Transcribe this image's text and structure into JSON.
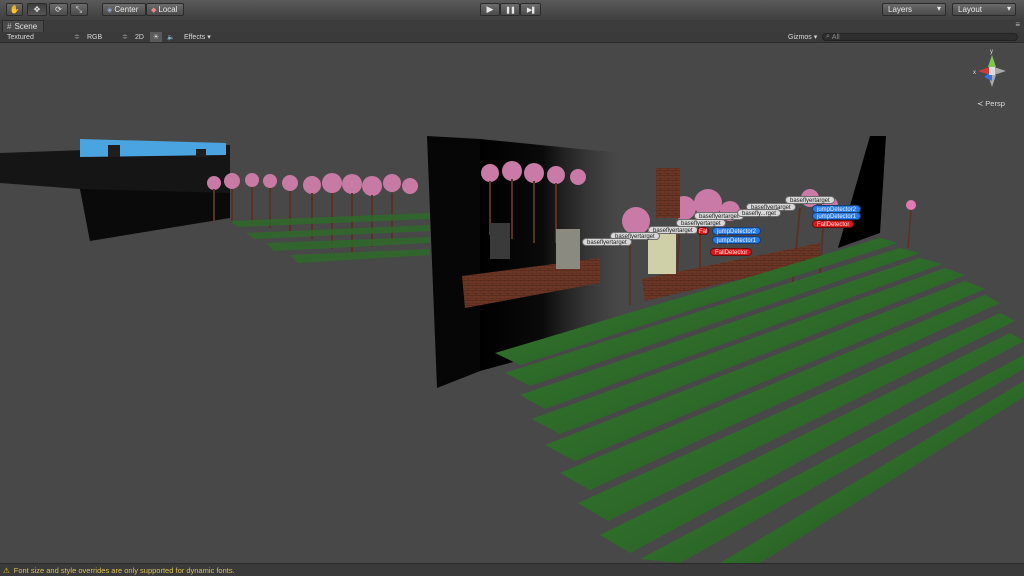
{
  "toolbar": {
    "tools": [
      {
        "name": "hand-tool",
        "glyph": "✋"
      },
      {
        "name": "move-tool",
        "glyph": "✥"
      },
      {
        "name": "rotate-tool",
        "glyph": "⟳"
      },
      {
        "name": "scale-tool",
        "glyph": "⤡"
      }
    ],
    "pivot_label": "Center",
    "space_label": "Local",
    "play_glyph": "▶",
    "pause_glyph": "❚❚",
    "step_glyph": "▶❚",
    "layers_label": "Layers",
    "layout_label": "Layout",
    "dropdown_arrow": "▾"
  },
  "tab": {
    "icon_glyph": "#",
    "label": "Scene"
  },
  "scene_options": {
    "render_mode": "Textured",
    "color_mode": "RGB",
    "mode_2d": "2D",
    "lighting_glyph": "☀",
    "audio_glyph": "🔈",
    "effects": "Effects",
    "gizmos": "Gizmos",
    "search_placeholder": "All",
    "arrow": "▾",
    "small_arrow": "≑"
  },
  "gizmo": {
    "axis_y": "y",
    "axis_x": "x",
    "projection": "Persp",
    "projection_glyph": "≺"
  },
  "object_labels": [
    {
      "text": "baseflyertarget",
      "style": "white"
    },
    {
      "text": "baseflyertarget",
      "style": "white"
    },
    {
      "text": "baseflyertarget",
      "style": "white"
    },
    {
      "text": "baseflyertarget",
      "style": "white"
    },
    {
      "text": "baseflyertarget",
      "style": "white"
    },
    {
      "text": "baseflyertarget",
      "style": "white"
    },
    {
      "text": "basefly...rget",
      "style": "white"
    },
    {
      "text": "baseflyertarget",
      "style": "white"
    },
    {
      "text": "jumpDetector2",
      "style": "blue"
    },
    {
      "text": "jumpDetector1",
      "style": "blue"
    },
    {
      "text": "FallDetector",
      "style": "red"
    },
    {
      "text": "jumpDetector2",
      "style": "blue"
    },
    {
      "text": "jumpDetector1",
      "style": "blue"
    },
    {
      "text": "FallDetector",
      "style": "red"
    },
    {
      "text": "Fal",
      "style": "red"
    }
  ],
  "status": {
    "warning_glyph": "⚠",
    "message": "Font size and style overrides are only supported for dynamic fonts."
  }
}
